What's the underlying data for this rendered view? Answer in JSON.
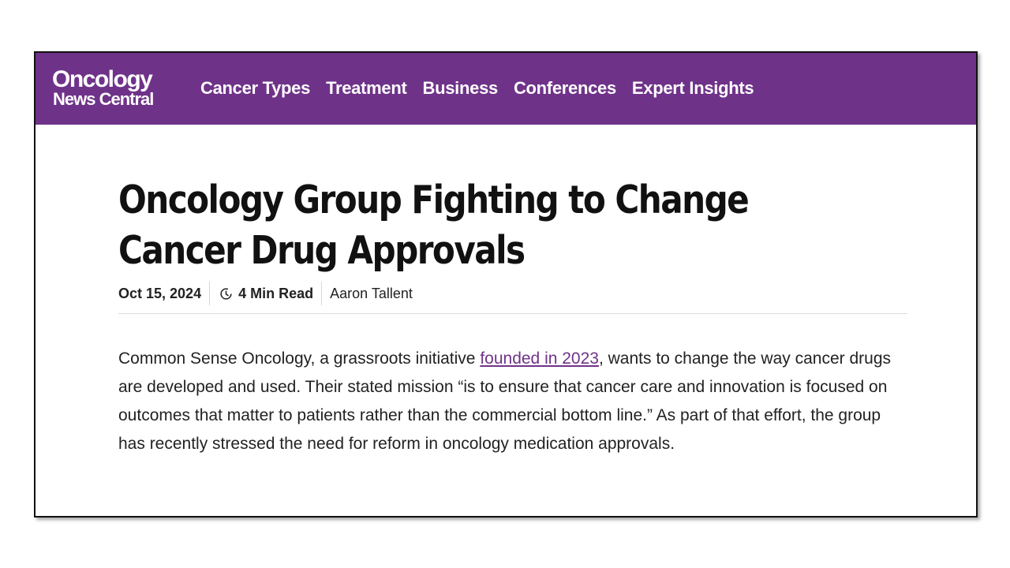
{
  "site": {
    "logo_line1": "Oncology",
    "logo_line2": "News Central",
    "brand_color": "#6f3289"
  },
  "nav": {
    "items": [
      {
        "label": "Cancer Types"
      },
      {
        "label": "Treatment"
      },
      {
        "label": "Business"
      },
      {
        "label": "Conferences"
      },
      {
        "label": "Expert Insights"
      }
    ]
  },
  "article": {
    "headline_line1": "Oncology Group Fighting to Change",
    "headline_line2": "Cancer Drug Approvals",
    "date": "Oct 15, 2024",
    "read_time": "4 Min Read",
    "read_time_icon": "clock-icon",
    "author": "Aaron Tallent",
    "body_before_link": "Common Sense Oncology, a grassroots initiative ",
    "body_link": "founded in 2023",
    "body_after_link": ", wants to change the way cancer drugs are developed and used. Their stated mission “is to ensure that cancer care and innovation is focused on outcomes that matter to patients rather than the commercial bottom line.” As part of that effort, the group has recently stressed the need for reform in oncology medication approvals."
  }
}
